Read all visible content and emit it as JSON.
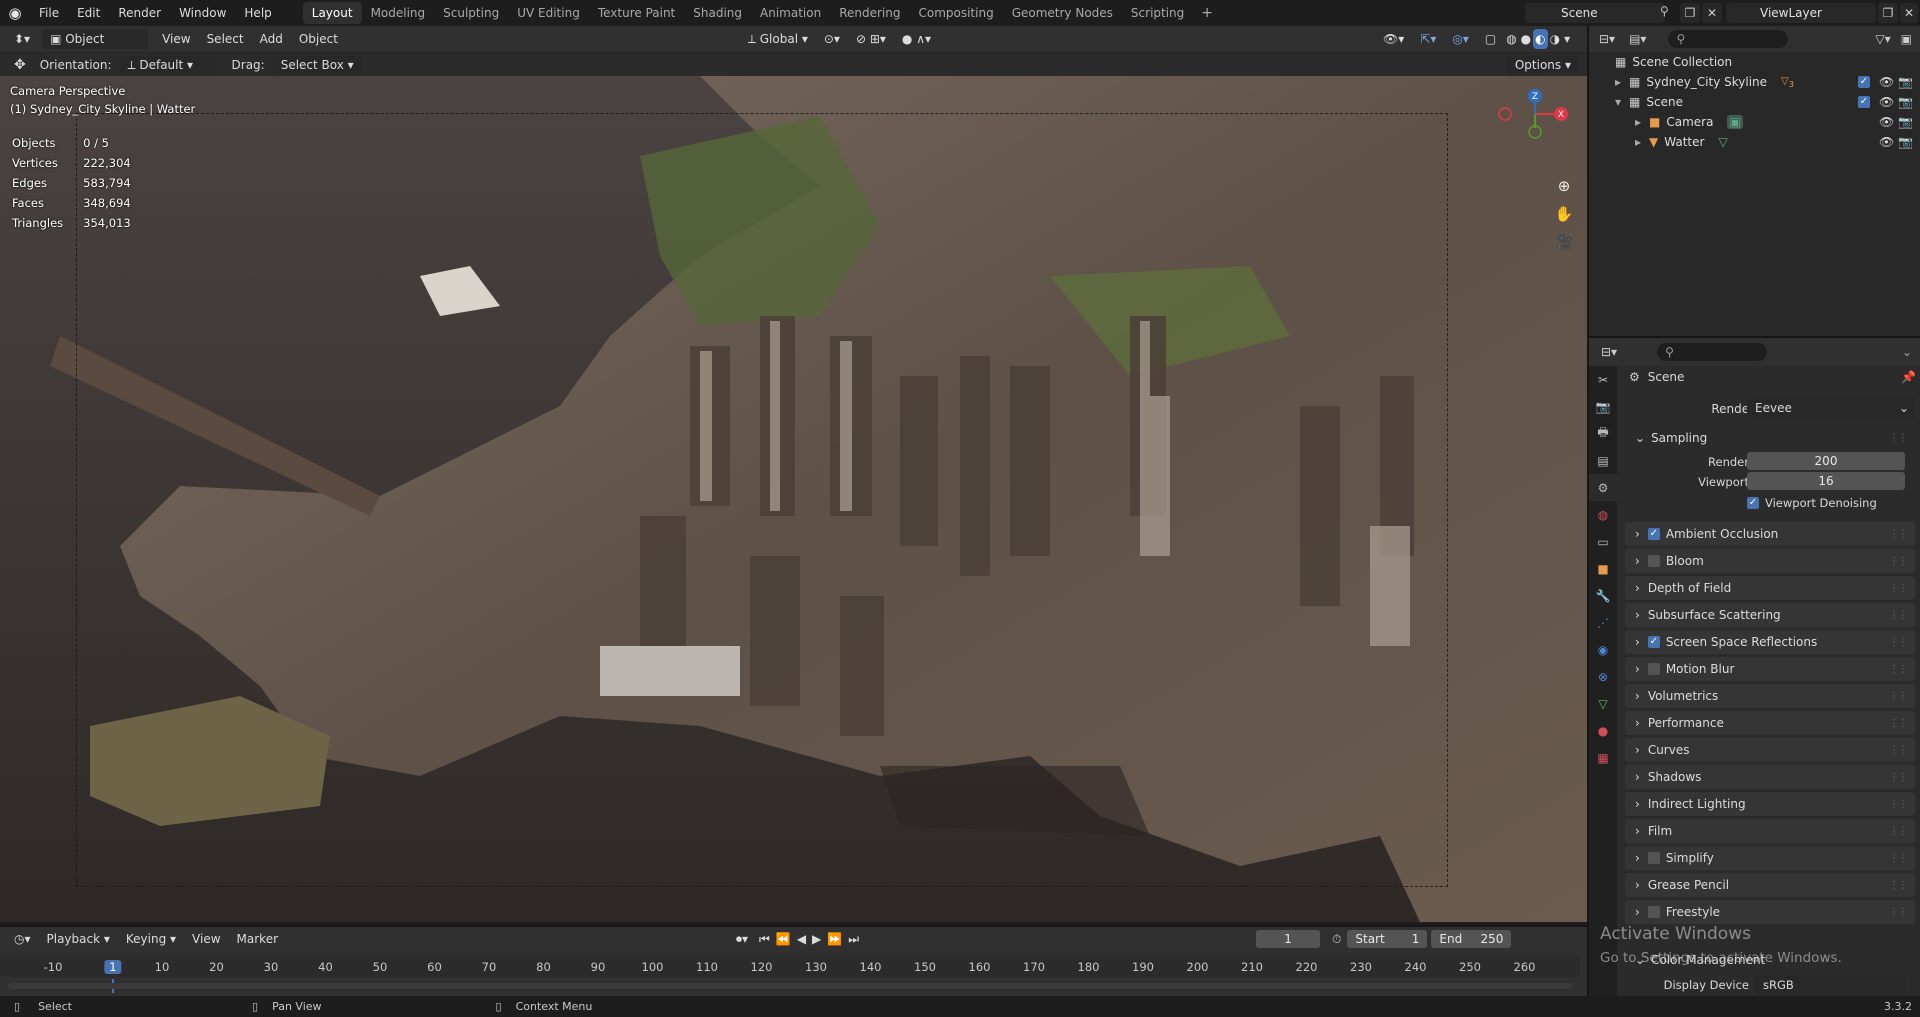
{
  "topbar": {
    "menus": [
      "File",
      "Edit",
      "Render",
      "Window",
      "Help"
    ],
    "workspaces": [
      "Layout",
      "Modeling",
      "Sculpting",
      "UV Editing",
      "Texture Paint",
      "Shading",
      "Animation",
      "Rendering",
      "Compositing",
      "Geometry Nodes",
      "Scripting"
    ],
    "active_workspace": "Layout",
    "scene_name": "Scene",
    "view_layer": "ViewLayer"
  },
  "viewport_header": {
    "mode": "Object Mode",
    "menus": [
      "View",
      "Select",
      "Add",
      "Object"
    ],
    "transform_orientation": "Global",
    "orientation_label": "Orientation:",
    "orientation_value": "Default",
    "drag_label": "Drag:",
    "drag_value": "Select Box",
    "options_label": "Options"
  },
  "viewport": {
    "camera_text": "Camera Perspective",
    "object_text": "(1) Sydney_City Skyline | Watter",
    "stats": [
      {
        "label": "Objects",
        "value": "0 / 5"
      },
      {
        "label": "Vertices",
        "value": "222,304"
      },
      {
        "label": "Edges",
        "value": "583,794"
      },
      {
        "label": "Faces",
        "value": "348,694"
      },
      {
        "label": "Triangles",
        "value": "354,013"
      }
    ],
    "gizmo": {
      "z": "Z",
      "x": "X"
    }
  },
  "outliner": {
    "root": "Scene Collection",
    "items": [
      {
        "name": "Sydney_City Skyline",
        "extra": "3"
      },
      {
        "name": "Scene"
      },
      {
        "name": "Camera"
      },
      {
        "name": "Watter"
      }
    ]
  },
  "properties": {
    "context": "Scene",
    "render_engine_label": "Render Engine",
    "render_engine_value": "Eevee",
    "sampling": {
      "title": "Sampling",
      "render_label": "Render",
      "render_value": "200",
      "viewport_label": "Viewport",
      "viewport_value": "16",
      "denoise_label": "Viewport Denoising"
    },
    "panels": [
      {
        "label": "Ambient Occlusion",
        "checkbox": true,
        "checked": true
      },
      {
        "label": "Bloom",
        "checkbox": true,
        "checked": false
      },
      {
        "label": "Depth of Field",
        "checkbox": false
      },
      {
        "label": "Subsurface Scattering",
        "checkbox": false
      },
      {
        "label": "Screen Space Reflections",
        "checkbox": true,
        "checked": true
      },
      {
        "label": "Motion Blur",
        "checkbox": true,
        "checked": false
      },
      {
        "label": "Volumetrics",
        "checkbox": false
      },
      {
        "label": "Performance",
        "checkbox": false
      },
      {
        "label": "Curves",
        "checkbox": false
      },
      {
        "label": "Shadows",
        "checkbox": false
      },
      {
        "label": "Indirect Lighting",
        "checkbox": false
      },
      {
        "label": "Film",
        "checkbox": false
      },
      {
        "label": "Simplify",
        "checkbox": true,
        "checked": false
      },
      {
        "label": "Grease Pencil",
        "checkbox": false
      },
      {
        "label": "Freestyle",
        "checkbox": true,
        "checked": false
      }
    ],
    "color_management": "Color Management",
    "display_device_label": "Display Device",
    "display_device_value": "sRGB"
  },
  "timeline": {
    "menus": [
      "Playback",
      "Keying",
      "View",
      "Marker"
    ],
    "current_frame": "1",
    "start_label": "Start",
    "start_value": "1",
    "end_label": "End",
    "end_value": "250",
    "ticks": [
      "-10",
      "1",
      "10",
      "20",
      "30",
      "40",
      "50",
      "60",
      "70",
      "80",
      "90",
      "100",
      "110",
      "120",
      "130",
      "140",
      "150",
      "160",
      "170",
      "180",
      "190",
      "200",
      "210",
      "220",
      "230",
      "240",
      "250",
      "260"
    ]
  },
  "watermark": {
    "title": "Activate Windows",
    "subtitle": "Go to Settings to activate Windows."
  },
  "statusbar": {
    "select": "Select",
    "pan": "Pan View",
    "context": "Context Menu",
    "version": "3.3.2"
  }
}
